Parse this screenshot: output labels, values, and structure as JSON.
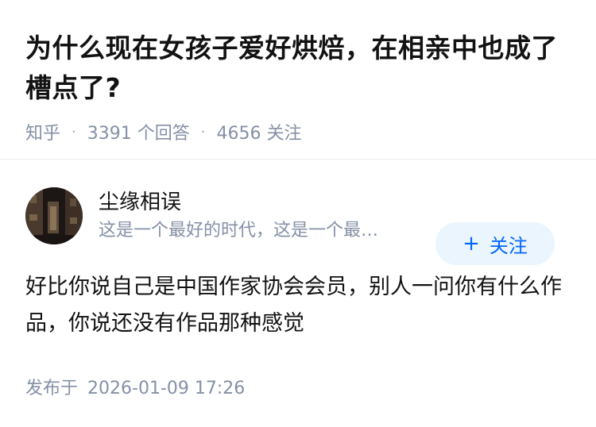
{
  "question": {
    "title": "为什么现在女孩子爱好烘焙，在相亲中也成了槽点了?",
    "source": "知乎",
    "answers_count": "3391 个回答",
    "followers_count": "4656 关注"
  },
  "answer": {
    "author_name": "尘缘相误",
    "author_bio": "这是一个最好的时代，这是一个最…",
    "follow_button": {
      "icon": "+",
      "label": "关注",
      "text_color": "#0066ff",
      "bg_color": "#ebf5fd"
    },
    "content": "好比你说自己是中国作家协会会员，别人一问你有什么作品，你说还没有作品那种感觉",
    "published_label": "发布于",
    "published_time": "2026-01-09 17:26"
  }
}
